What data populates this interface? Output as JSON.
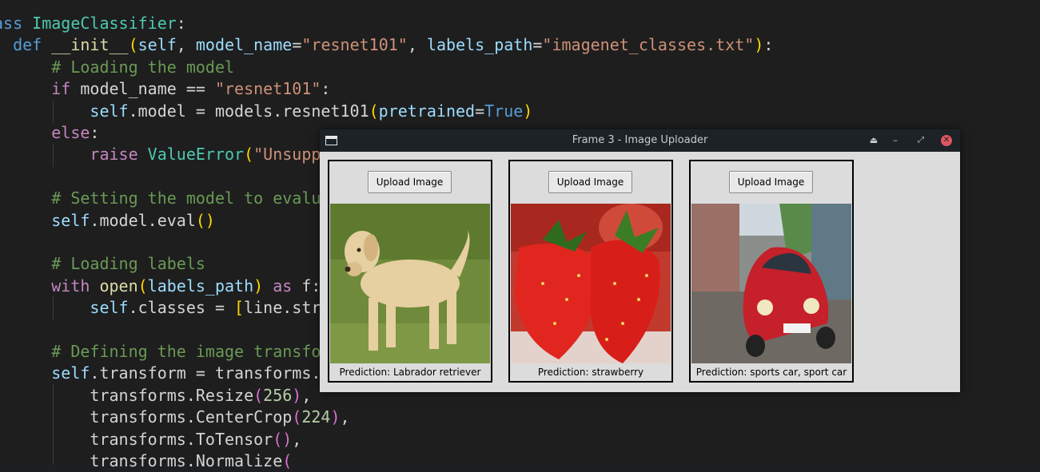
{
  "editor": {
    "lines": [
      [
        [
          "ass ",
          "kw2"
        ],
        [
          "ImageClassifier",
          "cls"
        ],
        [
          ":",
          ""
        ]
      ],
      [
        [
          "  def ",
          "kw2"
        ],
        [
          "__init__",
          "fn"
        ],
        [
          "(",
          "p1"
        ],
        [
          "self",
          "var"
        ],
        [
          ", ",
          ""
        ],
        [
          "model_name",
          "var"
        ],
        [
          "=",
          ""
        ],
        [
          "\"resnet101\"",
          "str"
        ],
        [
          ", ",
          ""
        ],
        [
          "labels_path",
          "var"
        ],
        [
          "=",
          ""
        ],
        [
          "\"imagenet_classes.txt\"",
          "str"
        ],
        [
          ")",
          "p1"
        ],
        [
          ":",
          ""
        ]
      ],
      [
        [
          "      # Loading the model",
          "com"
        ]
      ],
      [
        [
          "      if ",
          "kw"
        ],
        [
          "model_name == ",
          ""
        ],
        [
          "\"resnet101\"",
          "str"
        ],
        [
          ":",
          ""
        ]
      ],
      [
        [
          "          self",
          "var"
        ],
        [
          ".model = models.resnet101",
          ""
        ],
        [
          "(",
          "p1"
        ],
        [
          "pretrained",
          "var"
        ],
        [
          "=",
          ""
        ],
        [
          "True",
          "kw2"
        ],
        [
          ")",
          "p1"
        ]
      ],
      [
        [
          "      else",
          "kw"
        ],
        [
          ":",
          ""
        ]
      ],
      [
        [
          "          raise ",
          "kw"
        ],
        [
          "ValueError",
          "cls"
        ],
        [
          "(",
          "p1"
        ],
        [
          "\"Unsupp",
          "str"
        ]
      ],
      [
        [
          "",
          ""
        ]
      ],
      [
        [
          "      # Setting the model to evalu",
          "com"
        ]
      ],
      [
        [
          "      self",
          "var"
        ],
        [
          ".model.eval",
          ""
        ],
        [
          "()",
          "p1"
        ]
      ],
      [
        [
          "",
          ""
        ]
      ],
      [
        [
          "      # Loading labels",
          "com"
        ]
      ],
      [
        [
          "      with ",
          "kw"
        ],
        [
          "open",
          "fn"
        ],
        [
          "(",
          "p1"
        ],
        [
          "labels_path",
          "var"
        ],
        [
          ") ",
          "p1"
        ],
        [
          "as ",
          "kw"
        ],
        [
          "f:",
          ""
        ]
      ],
      [
        [
          "          self",
          "var"
        ],
        [
          ".classes = ",
          ""
        ],
        [
          "[",
          "p1"
        ],
        [
          "line.str",
          ""
        ]
      ],
      [
        [
          "",
          ""
        ]
      ],
      [
        [
          "      # Defining the image transfo",
          "com"
        ]
      ],
      [
        [
          "      self",
          "var"
        ],
        [
          ".transform = transforms.",
          ""
        ]
      ],
      [
        [
          "          transforms.Resize",
          ""
        ],
        [
          "(",
          "p2"
        ],
        [
          "256",
          "num"
        ],
        [
          ")",
          "p2"
        ],
        [
          ",",
          ""
        ]
      ],
      [
        [
          "          transforms.CenterCrop",
          ""
        ],
        [
          "(",
          "p2"
        ],
        [
          "224",
          "num"
        ],
        [
          ")",
          "p2"
        ],
        [
          ",",
          ""
        ]
      ],
      [
        [
          "          transforms.ToTensor",
          ""
        ],
        [
          "()",
          "p2"
        ],
        [
          ",",
          ""
        ]
      ],
      [
        [
          "          transforms.Normalize",
          ""
        ],
        [
          "(",
          "p2"
        ]
      ]
    ]
  },
  "window": {
    "title": "Frame 3 - Image Uploader",
    "controls": {
      "eject": "⏏",
      "minimize": "–",
      "restore": "⤢",
      "close": "✕"
    }
  },
  "frames": [
    {
      "button_label": "Upload Image",
      "image": "labrador-dog-photo",
      "prediction": "Prediction: Labrador retriever"
    },
    {
      "button_label": "Upload Image",
      "image": "strawberries-photo",
      "prediction": "Prediction: strawberry"
    },
    {
      "button_label": "Upload Image",
      "image": "red-beetle-car-photo",
      "prediction": "Prediction: sports car, sport car"
    }
  ],
  "colors": {
    "editor_bg": "#1e1e1e",
    "titlebar_bg": "#1c2226",
    "window_bg": "#dcdcdc",
    "close_button": "#e05561"
  }
}
